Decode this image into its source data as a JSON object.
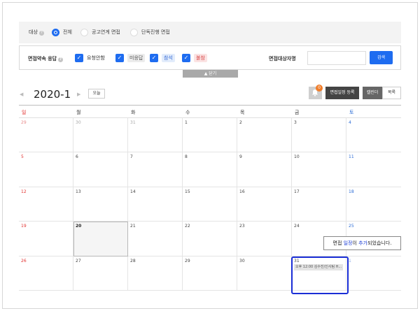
{
  "filter_target": {
    "label": "대상",
    "options": [
      "전체",
      "공고연계 면접",
      "단독진행 면접"
    ],
    "selected": "전체"
  },
  "filter_response": {
    "label": "면접약속 응답",
    "options": [
      {
        "label": "요청안함",
        "checked": true
      },
      {
        "label": "미응답",
        "checked": true
      },
      {
        "label": "참석",
        "checked": true
      },
      {
        "label": "불참",
        "checked": true
      }
    ]
  },
  "search": {
    "label": "면접대상자명",
    "placeholder": "",
    "button": "검색"
  },
  "collapse_label": "▲ 닫기",
  "calendar_header": {
    "prev": "◀",
    "next": "▶",
    "month": "2020-1",
    "today_button": "오늘",
    "notification_count": "0",
    "register_button": "면접일정 등록",
    "calendar_button": "캘린더",
    "list_button": "목록"
  },
  "weekdays": [
    "일",
    "월",
    "화",
    "수",
    "목",
    "금",
    "토"
  ],
  "days": [
    [
      "29",
      "30",
      "31",
      "1",
      "2",
      "3",
      "4"
    ],
    [
      "5",
      "6",
      "7",
      "8",
      "9",
      "10",
      "11"
    ],
    [
      "12",
      "13",
      "14",
      "15",
      "16",
      "17",
      "18"
    ],
    [
      "19",
      "20",
      "21",
      "22",
      "23",
      "24",
      "25"
    ],
    [
      "26",
      "27",
      "28",
      "29",
      "30",
      "31",
      "1"
    ]
  ],
  "event": {
    "text": "오후 12:00 김수진/인사팀 H..."
  },
  "toast": {
    "part1": "면접 ",
    "part2": "일정",
    "part3": "이 ",
    "part4": "추가",
    "part5": "되었습니다."
  },
  "colors": {
    "accent": "#1e6cf0",
    "sunday": "#e2302f",
    "saturday": "#2b6cd6",
    "highlight": "#1a2ed6"
  }
}
